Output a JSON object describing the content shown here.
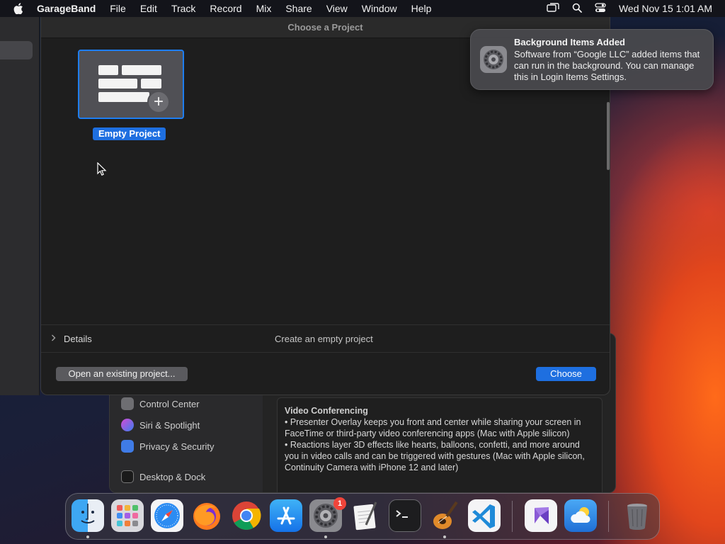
{
  "menubar": {
    "app_name": "GarageBand",
    "items": [
      "File",
      "Edit",
      "Track",
      "Record",
      "Mix",
      "Share",
      "View",
      "Window",
      "Help"
    ],
    "clock": "Wed Nov 15  1:01 AM"
  },
  "dialog": {
    "title": "Choose a Project",
    "project_label": "Empty Project",
    "details_label": "Details",
    "details_description": "Create an empty project",
    "open_button": "Open an existing project...",
    "choose_button": "Choose"
  },
  "notification": {
    "title": "Background Items Added",
    "body": "Software from “Google LLC” added items that can run in the background. You can manage this in Login Items Settings."
  },
  "settings_window": {
    "sidebar_items": [
      "Control Center",
      "Siri & Spotlight",
      "Privacy & Security",
      "Desktop & Dock"
    ],
    "content_title": "Video Conferencing",
    "content_lines": [
      "• Presenter Overlay keeps you front and center while sharing your screen in FaceTime or third-party video conferencing apps (Mac with Apple silicon)",
      "• Reactions layer 3D effects like hearts, balloons, confetti, and more around you in video calls and can be triggered with gestures (Mac with Apple silicon, Continuity Camera with iPhone 12 and later)"
    ]
  },
  "dock": {
    "system_settings_badge": "1"
  },
  "colors": {
    "accent": "#1e6fe0",
    "badge": "#f0443a"
  }
}
